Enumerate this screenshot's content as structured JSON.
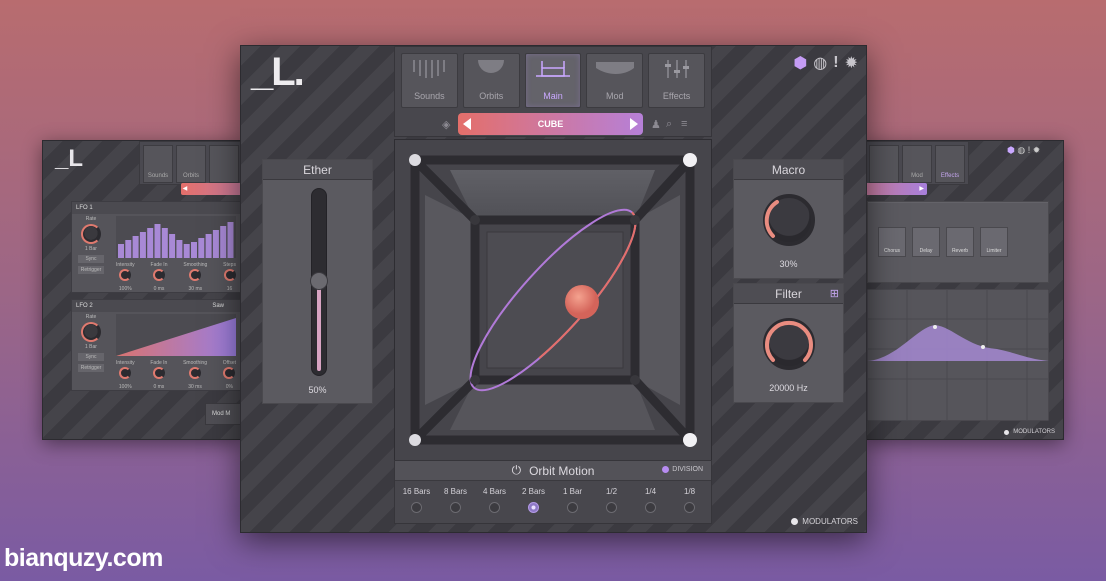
{
  "main": {
    "logo": "_L.",
    "tabs": [
      {
        "label": "Sounds"
      },
      {
        "label": "Orbits"
      },
      {
        "label": "Main",
        "active": true
      },
      {
        "label": "Mod"
      },
      {
        "label": "Effects"
      }
    ],
    "preset": "CUBE",
    "ether": {
      "title": "Ether",
      "value_text": "50%",
      "level": 0.5
    },
    "macro": {
      "title": "Macro",
      "value_text": "30%",
      "level": 0.3
    },
    "filter": {
      "title": "Filter",
      "value_text": "20000 Hz"
    },
    "orbit_motion": {
      "title": "Orbit Motion",
      "division_label": "DIVISION",
      "options": [
        "16 Bars",
        "8 Bars",
        "4 Bars",
        "2 Bars",
        "1 Bar",
        "1/2",
        "1/4",
        "1/8"
      ],
      "selected": "2 Bars"
    },
    "modulators_label": "MODULATORS",
    "icons": [
      "cube-icon",
      "globe-icon",
      "alert-icon",
      "gear-icon"
    ]
  },
  "left_window": {
    "logo": "_L",
    "tabs": [
      "Sounds",
      "Orbits"
    ],
    "lfo1": {
      "title": "LFO 1",
      "rate_label": "Rate",
      "rate_value": "1 Bar",
      "sync_label": "Sync",
      "retrigger_label": "Retrigger",
      "params": [
        "Intensity",
        "Fade In",
        "Smoothing",
        "Steps"
      ],
      "values": [
        "100%",
        "0 ms",
        "30 ms",
        "16"
      ]
    },
    "lfo2": {
      "title": "LFO 2",
      "shape": "Saw",
      "rate_label": "Rate",
      "rate_value": "1 Bar",
      "sync_label": "Sync",
      "retrigger_label": "Retrigger",
      "params": [
        "Intensity",
        "Fade In",
        "Smoothing",
        "Offset"
      ],
      "values": [
        "100%",
        "0 ms",
        "30 ms",
        "0%"
      ]
    },
    "button_label": "Mod M"
  },
  "right_window": {
    "tabs": [
      "Mod",
      "Effects"
    ],
    "effects": [
      "Chorus",
      "Delay",
      "Reverb",
      "Limiter"
    ],
    "modulators_label": "MODULATORS"
  },
  "watermark": "bianquzy.com",
  "colors": {
    "accent_purple": "#b78cf1",
    "accent_coral": "#e46f6a",
    "panel": "#5b5a60"
  }
}
